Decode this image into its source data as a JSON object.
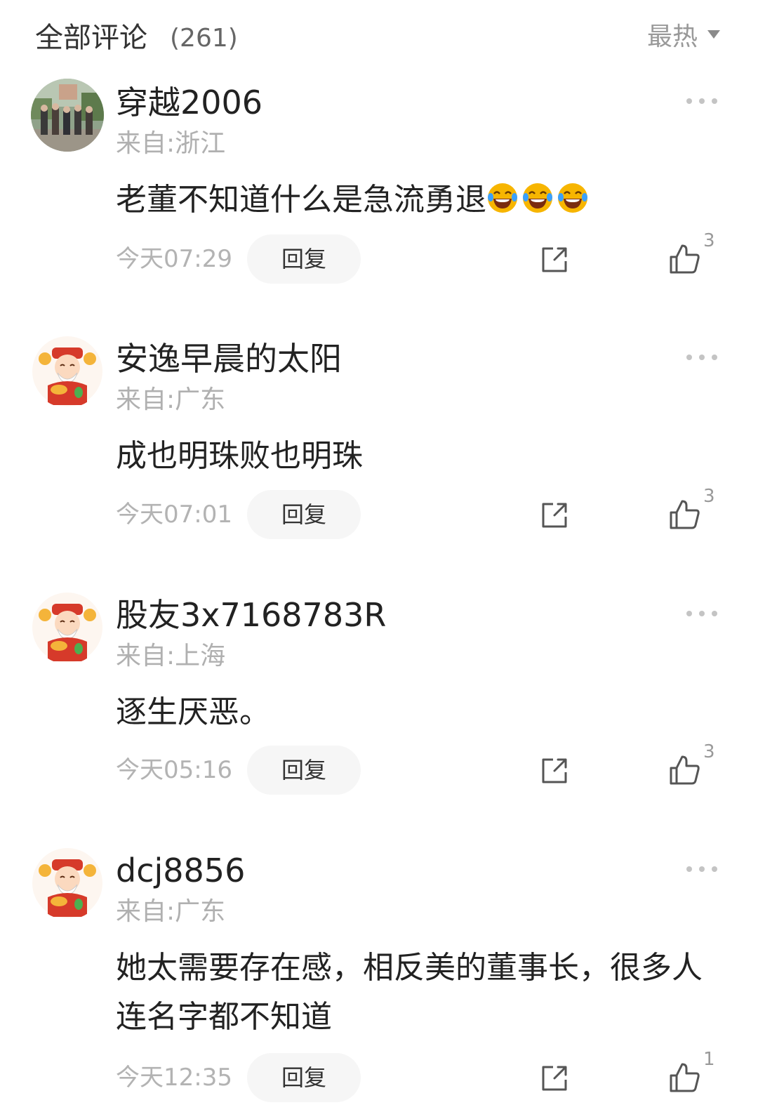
{
  "header": {
    "title": "全部评论",
    "count": "(261)",
    "sort_label": "最热"
  },
  "comments": [
    {
      "avatar": "group-photo-avatar",
      "username": "穿越2006",
      "location": "来自:浙江",
      "text": "老董不知道什么是急流勇退",
      "emojis": [
        "laughing-tears-emoji",
        "laughing-tears-emoji",
        "laughing-tears-emoji"
      ],
      "time": "今天07:29",
      "reply_label": "回复",
      "likes": "3"
    },
    {
      "avatar": "fortune-god-avatar",
      "username": "安逸早晨的太阳",
      "location": "来自:广东",
      "text": "成也明珠败也明珠",
      "time": "今天07:01",
      "reply_label": "回复",
      "likes": "3"
    },
    {
      "avatar": "fortune-god-avatar",
      "username": "股友3x7168783R",
      "location": "来自:上海",
      "text": "逐生厌恶。",
      "time": "今天05:16",
      "reply_label": "回复",
      "likes": "3"
    },
    {
      "avatar": "fortune-god-avatar",
      "username": "dcj8856",
      "location": "来自:广东",
      "text": "她太需要存在感，相反美的董事长，很多人连名字都不知道",
      "time": "今天12:35",
      "reply_label": "回复",
      "likes": "1"
    }
  ],
  "icons": {
    "share": "share-icon",
    "like": "thumbs-up-icon",
    "more": "more-dots-icon",
    "sort": "caret-down-icon"
  },
  "colors": {
    "text_primary": "#222222",
    "text_secondary": "#b0b0b0",
    "reply_bg": "#f6f6f6",
    "emoji_yellow": "#f7b500"
  }
}
